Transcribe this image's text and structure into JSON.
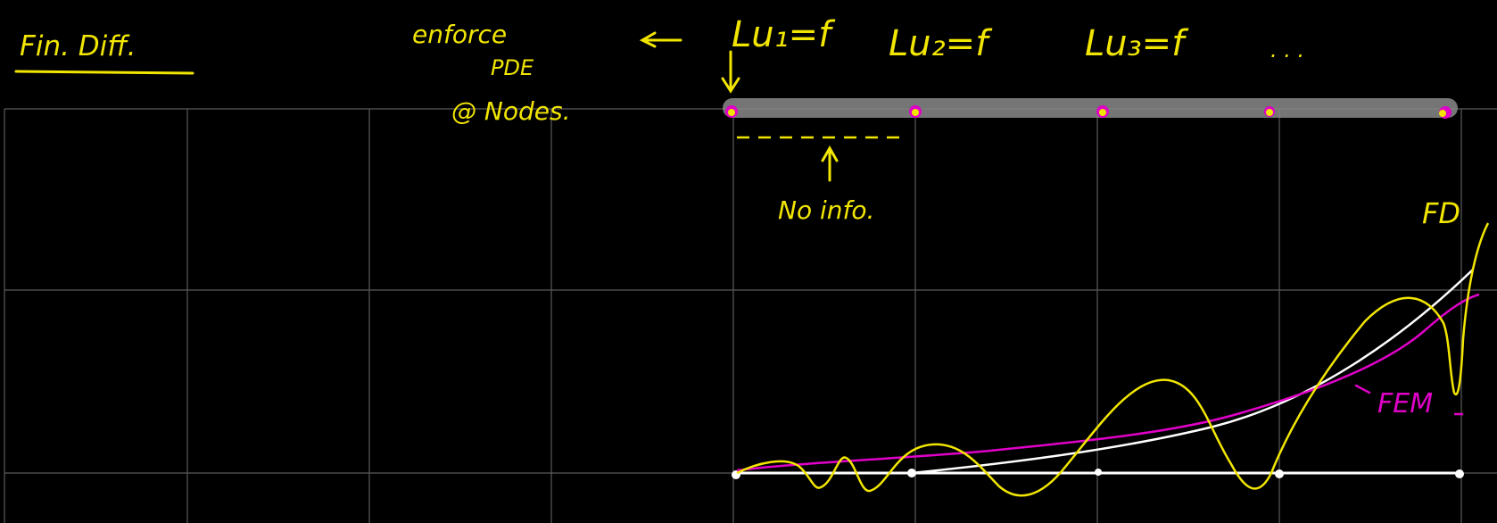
{
  "colors": {
    "background": "#000000",
    "grid": "#5a5a5a",
    "annotation": "#f2e600",
    "fem": "#e000c8",
    "exact": "#ffffff",
    "highlight": "#8a8a8a"
  },
  "title": "Fin. Diff.",
  "note_enforce": "enforce",
  "note_pde": "PDE",
  "note_nodes": "@ Nodes.",
  "eq1": "Lu₁=f",
  "eq2": "Lu₂=f",
  "eq3": "Lu₃=f",
  "ellipsis": ". . .",
  "no_info": "No info.",
  "label_fd": "FD",
  "label_fem": "FEM"
}
